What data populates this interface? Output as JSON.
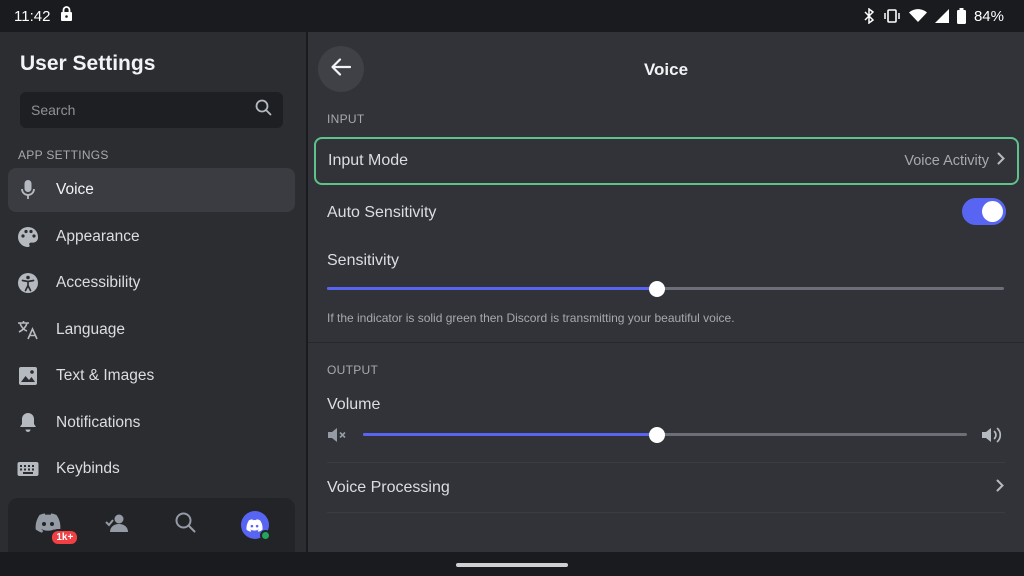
{
  "status_bar": {
    "time": "11:42",
    "battery": "84%"
  },
  "sidebar": {
    "title": "User Settings",
    "search_placeholder": "Search",
    "section_label": "APP SETTINGS",
    "items": [
      {
        "label": "Voice",
        "icon": "microphone-icon",
        "active": true
      },
      {
        "label": "Appearance",
        "icon": "palette-icon"
      },
      {
        "label": "Accessibility",
        "icon": "accessibility-icon"
      },
      {
        "label": "Language",
        "icon": "translate-icon"
      },
      {
        "label": "Text & Images",
        "icon": "image-icon"
      },
      {
        "label": "Notifications",
        "icon": "bell-icon"
      },
      {
        "label": "Keybinds",
        "icon": "keyboard-icon"
      }
    ]
  },
  "tab_bar": {
    "items": [
      "home-icon",
      "friends-icon",
      "search-icon",
      "avatar"
    ],
    "home_badge": "1k+"
  },
  "main": {
    "title": "Voice",
    "input": {
      "label": "INPUT",
      "input_mode": {
        "label": "Input Mode",
        "value": "Voice Activity"
      },
      "auto_sensitivity": {
        "label": "Auto Sensitivity",
        "enabled": true
      },
      "sensitivity": {
        "label": "Sensitivity",
        "value": 0.487
      },
      "helper": "If the indicator is solid green then Discord is transmitting your beautiful voice."
    },
    "output": {
      "label": "OUTPUT",
      "volume": {
        "label": "Volume",
        "value": 0.487
      },
      "voice_processing": {
        "label": "Voice Processing"
      }
    }
  },
  "colors": {
    "accent": "#5865f2",
    "focus_outline": "#5fc28a",
    "badge": "#f23f43",
    "online": "#23a55a"
  }
}
